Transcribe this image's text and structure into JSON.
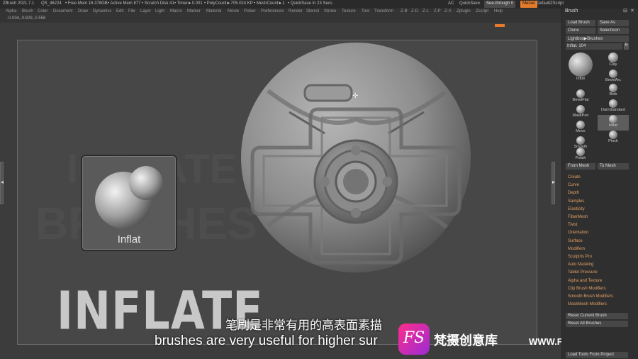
{
  "titlebar": {
    "app": "ZBrush 2021.7.1",
    "project": "QS_46224",
    "free_mem": "• Free Mem 16.378GB",
    "active_mem": "• Active Mem 877",
    "scratch": "• Scratch Disk 41",
    "timer": "• Timer►0.001",
    "polycount": "• PolyCount►705.024 KP",
    "meshcount": "• MeshCount►1",
    "quicksave_in": "• QuickSave In 23 Secs",
    "ac": "AC",
    "quicksave": "QuickSave",
    "see_through": "See-through",
    "see_through_val": "0",
    "menus": "Menus",
    "default_script": "DefaultZScript"
  },
  "menubar": {
    "items": [
      "Alpha",
      "Brush",
      "Color",
      "Document",
      "Draw",
      "Dynamics",
      "Edit",
      "File",
      "Layer",
      "Light",
      "Macro",
      "Marker",
      "Material",
      "Movie",
      "Picker",
      "Preferences",
      "Render",
      "Stencil",
      "Stroke",
      "Texture",
      "Tool",
      "Transform",
      "Z-B",
      "Z-D",
      "Z-L",
      "Z-P",
      "Z-X",
      "Zplugin",
      "Zscript",
      "Help"
    ]
  },
  "coords": "-0.004,-0.829,-0.558",
  "canvas": {
    "bg_text_line1": "INFLATE",
    "bg_text_line2": "BRUSHES",
    "brush_card_label": "Inflat",
    "big_word": "INFLATE"
  },
  "subtitles": {
    "cn": "笔刷是非常有用的高表面素描",
    "en": "brushes are very useful for higher sur"
  },
  "watermark": {
    "logo_letters": "FS",
    "cn": "梵摄创意库",
    "url": "WWW.FSTVC.CC"
  },
  "panel": {
    "title": "Brush",
    "load_brush": "Load Brush",
    "save_as": "Save As",
    "clone": "Clone",
    "select_icon": "SelectIcon",
    "lightbox": "Lightbox▶Brushes",
    "slider_label": "Inflat. 104",
    "slider_r": "R",
    "thumbs": [
      {
        "label": "Inflat",
        "selected": false
      },
      {
        "label": "Clay",
        "selected": false
      },
      {
        "label": "BevelArc",
        "selected": false
      },
      {
        "label": "BevelFlat",
        "selected": false
      },
      {
        "label": "Blob",
        "selected": false
      },
      {
        "label": "MaskPen",
        "selected": false
      },
      {
        "label": "DamStandard",
        "selected": false
      },
      {
        "label": "Move",
        "selected": false
      },
      {
        "label": "Inflat",
        "selected": true
      },
      {
        "label": "Smooth",
        "selected": false
      },
      {
        "label": "Pinch",
        "selected": false
      },
      {
        "label": "Polish",
        "selected": false
      }
    ],
    "from_mesh": "From Mesh",
    "to_mesh": "To Mesh",
    "subpalettes": [
      "Create",
      "Curve",
      "Depth",
      "Samples",
      "Elasticity",
      "FiberMesh",
      "Twist",
      "Orientation",
      "Surface",
      "Modifiers",
      "Sculptris Pro",
      "Auto Masking",
      "Tablet Pressure",
      "Alpha and Texture",
      "Clip Brush Modifiers",
      "Smooth Brush Modifiers",
      "MaskMesh Modifiers"
    ],
    "reset_current": "Reset Current Brush",
    "reset_all": "Reset All Brushes",
    "load_tools": "Load Tools From Project"
  },
  "colors": {
    "accent": "#e37a2c",
    "subpalette_text": "#e0a063"
  }
}
